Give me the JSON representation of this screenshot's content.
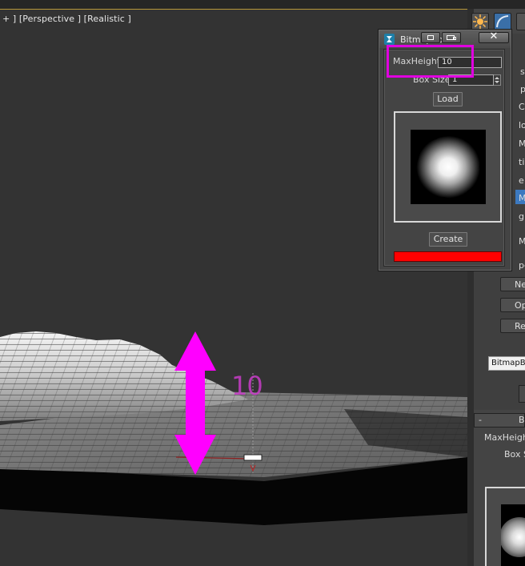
{
  "viewport": {
    "label": "+ ] [Perspective ] [Realistic ]"
  },
  "dialog": {
    "title": "BitmapBo",
    "close_glyph": "✕",
    "max_height_label": "MaxHeight",
    "max_height_value": "10",
    "box_size_label": "Box Size",
    "box_size_value": "1",
    "load_label": "Load",
    "create_label": "Create",
    "color_swatch": "#ff0000"
  },
  "annotation": {
    "value_label": "10",
    "color": "#ff00ff"
  },
  "command_panel": {
    "fragments": [
      "s",
      "p",
      "C",
      "lo",
      "M",
      "ti",
      "e",
      "M",
      "gh",
      "M",
      "pe"
    ],
    "buttons": [
      "Ne",
      "Op",
      "Re"
    ],
    "object_name": "BitmapBo",
    "rollout_title": "Bi",
    "rollout_toggle": "-",
    "max_height_label": "MaxHeight",
    "box_size_label": "Box S"
  },
  "icons": {
    "sun": "sun-icon",
    "curve": "curve-icon",
    "app": "3dsmax-app-icon",
    "minimize": "minimize-icon",
    "restore": "restore-icon",
    "close": "close-icon",
    "arrow": "double-arrow-icon",
    "spinner": "spinner-arrows-icon"
  }
}
